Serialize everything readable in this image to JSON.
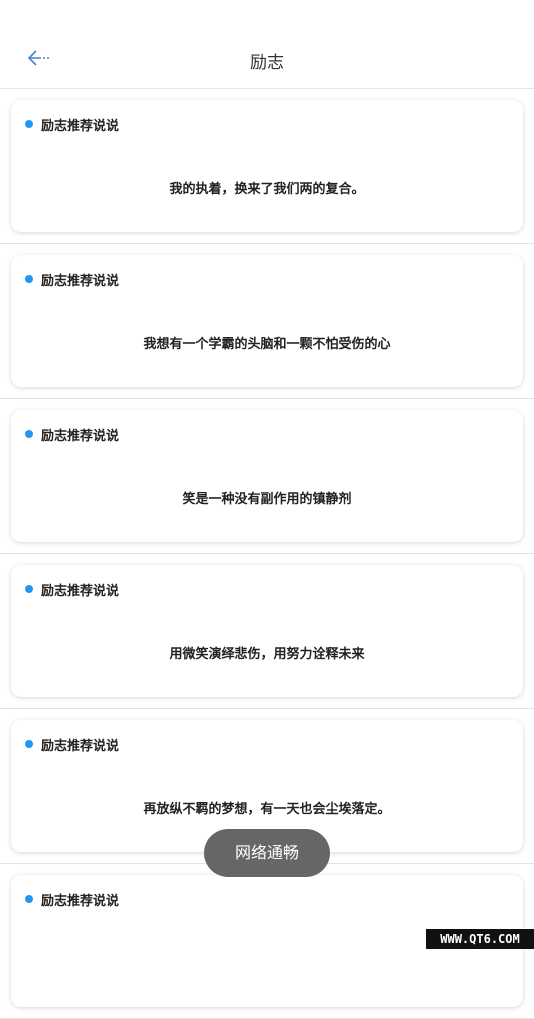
{
  "header": {
    "title": "励志",
    "back_icon": "arrow-left-icon"
  },
  "accent_color": "#2196f3",
  "cards": [
    {
      "label": "励志推荐说说",
      "text": "我的执着，换来了我们两的复合。"
    },
    {
      "label": "励志推荐说说",
      "text": "我想有一个学霸的头脑和一颗不怕受伤的心"
    },
    {
      "label": "励志推荐说说",
      "text": "笑是一种没有副作用的镇静剂"
    },
    {
      "label": "励志推荐说说",
      "text": "用微笑演绎悲伤，用努力诠释未来"
    },
    {
      "label": "励志推荐说说",
      "text": "再放纵不羁的梦想，有一天也会尘埃落定。"
    },
    {
      "label": "励志推荐说说",
      "text": ""
    }
  ],
  "toast": "网络通畅",
  "watermark": "WWW.QT6.COM"
}
